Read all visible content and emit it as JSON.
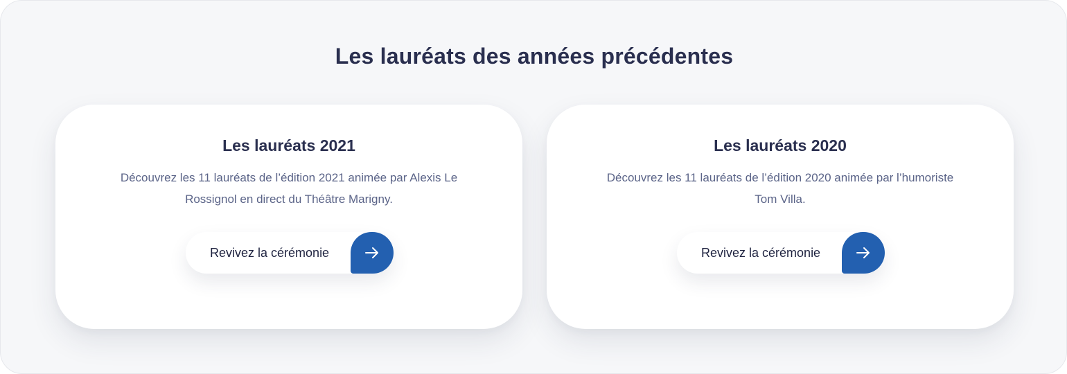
{
  "section": {
    "title": "Les lauréats des années précédentes"
  },
  "cards": [
    {
      "title": "Les lauréats 2021",
      "description": "Découvrez les 11 lauréats de l’édition 2021 animée par Alexis Le Rossignol en direct du Théâtre Marigny.",
      "button_label": "Revivez la cérémonie",
      "button_icon": "arrow-right-icon"
    },
    {
      "title": "Les lauréats 2020",
      "description": "Découvrez les 11 lauréats de l’édition 2020 animée par l’humoriste Tom Villa.",
      "button_label": "Revivez la cérémonie",
      "button_icon": "arrow-right-icon"
    }
  ],
  "colors": {
    "background": "#f6f7f9",
    "heading": "#2a2f4f",
    "body_text": "#5b6488",
    "accent": "#2360b0",
    "card": "#ffffff"
  }
}
